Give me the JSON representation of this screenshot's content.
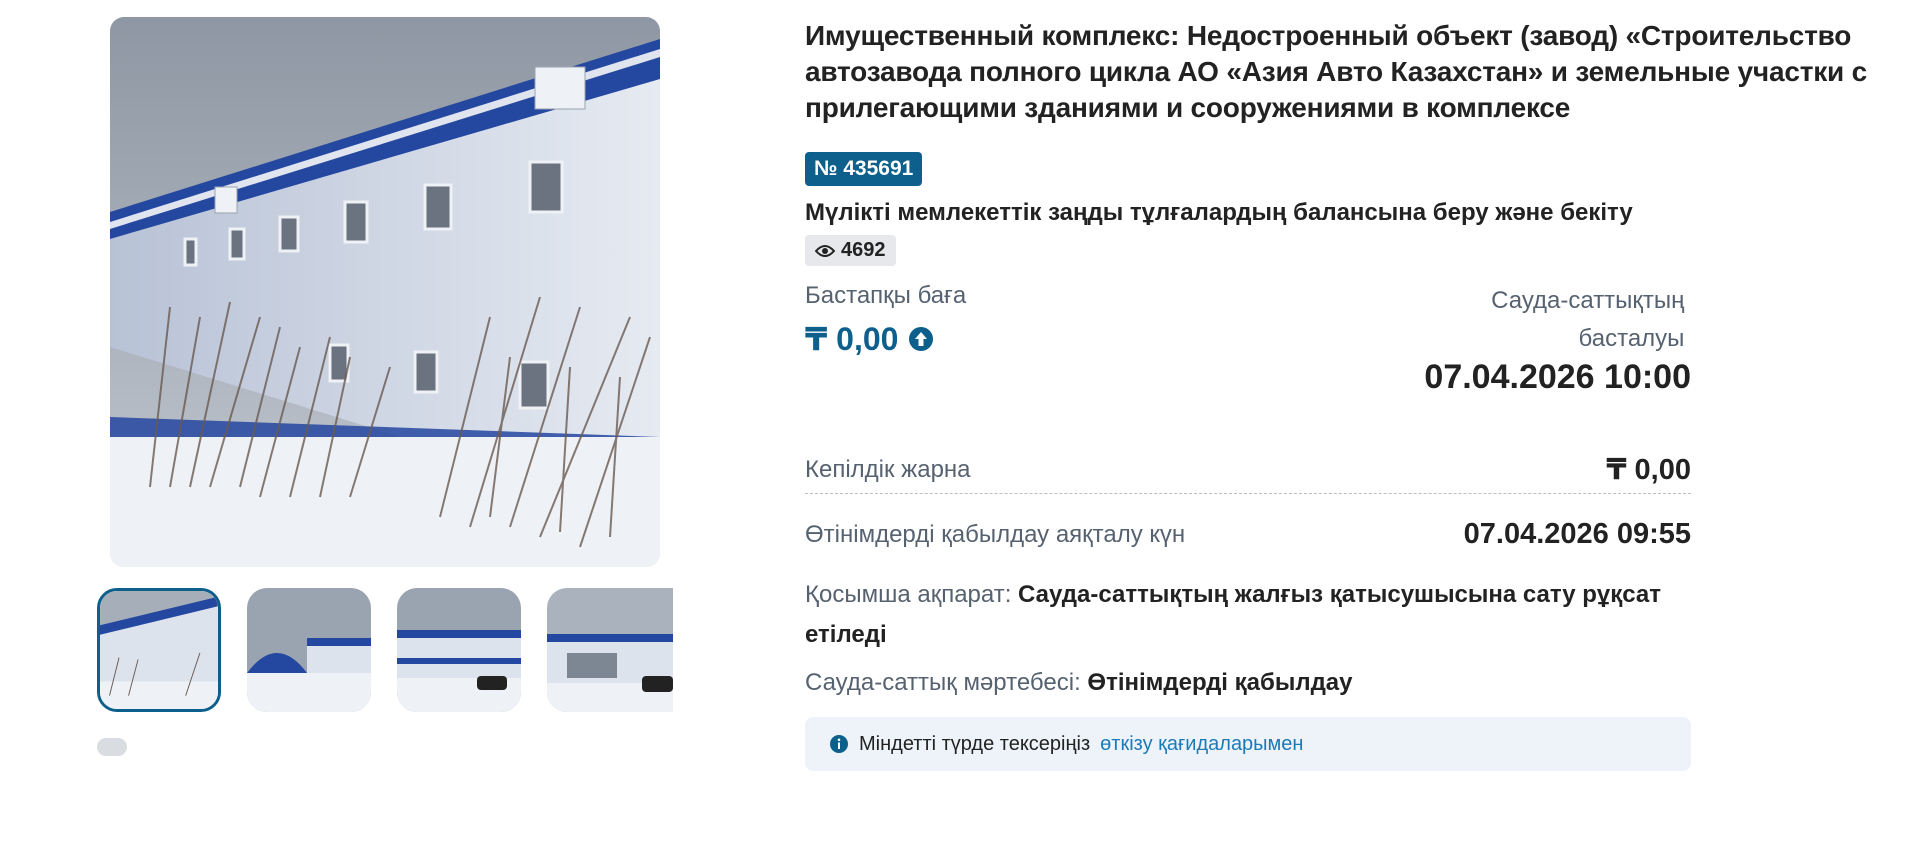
{
  "gallery": {
    "main_image_alt": "building-photo",
    "thumbnails": [
      "building-side",
      "hangar-yard",
      "factory-front",
      "factory-entrance"
    ]
  },
  "lot": {
    "title": "Имущественный комплекс: Недостроенный объект (завод) «Строительство автозавода полного цикла АО «Азия Авто Казахстан» и земельные участки с прилегающими зданиями и сооружениями в комплексе",
    "number": "№ 435691",
    "category": "Мүлікті мемлекеттік заңды тұлғалардың балансына беру және бекіту",
    "views": "4692"
  },
  "price": {
    "label": "Бастапқы баға",
    "value": "₸ 0,00"
  },
  "start": {
    "label": "Сауда-саттықтың басталуы",
    "value": "07.04.2026 10:00"
  },
  "deposit": {
    "label": "Кепілдік жарна",
    "value": "₸ 0,00"
  },
  "deadline": {
    "label": "Өтінімдерді қабылдау аяқталу күн",
    "value": "07.04.2026 09:55"
  },
  "additional": {
    "label": "Қосымша ақпарат:",
    "value": "Сауда-саттықтың жалғыз қатысушысына сату рұқсат етіледі"
  },
  "status": {
    "label": "Сауда-саттық мәртебесі:",
    "value": "Өтінімдерді қабылдау"
  },
  "notice": {
    "text": "Міндетті түрде тексеріңіз",
    "link": "өткізу қағидаларымен"
  },
  "colors": {
    "accent": "#0d5f8c",
    "link": "#1b7ab8",
    "muted": "#566270",
    "notice_bg": "#eef3fa"
  }
}
